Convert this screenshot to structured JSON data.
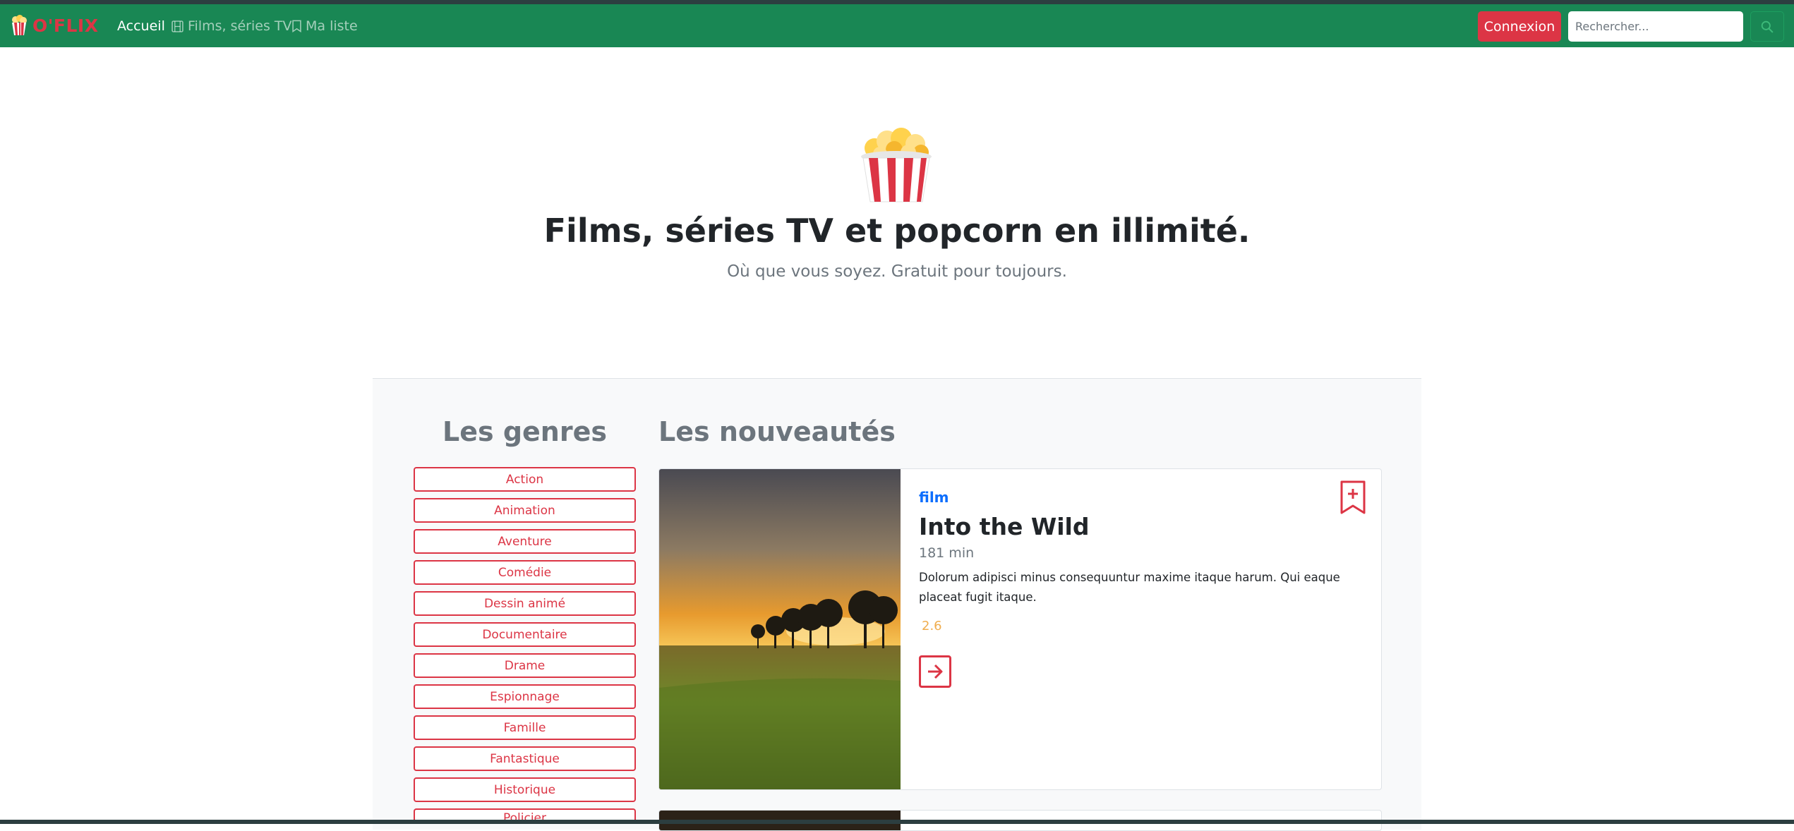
{
  "navbar": {
    "brand": "O'FLIX",
    "links": [
      {
        "label": "Accueil"
      },
      {
        "label": "Films, séries TV"
      },
      {
        "label": "Ma liste"
      }
    ],
    "login_label": "Connexion",
    "search_placeholder": "Rechercher..."
  },
  "hero": {
    "title": "Films, séries TV et popcorn en illimité.",
    "subtitle": "Où que vous soyez. Gratuit pour toujours."
  },
  "genres": {
    "title": "Les genres",
    "items": [
      "Action",
      "Animation",
      "Aventure",
      "Comédie",
      "Dessin animé",
      "Documentaire",
      "Drame",
      "Espionnage",
      "Famille",
      "Fantastique",
      "Historique",
      "Policier"
    ]
  },
  "news": {
    "title": "Les nouveautés",
    "cards": [
      {
        "type": "film",
        "title": "Into the Wild",
        "duration": "181 min",
        "description": "Dolorum adipisci minus consequuntur maxime itaque harum. Qui eaque placeat fugit itaque.",
        "rating": "2.6"
      }
    ]
  },
  "colors": {
    "navbar": "#198754",
    "accent": "#dc3545",
    "type_label": "#0d6efd",
    "rating": "#f0ad4e"
  },
  "icons": [
    "popcorn-icon",
    "film-icon",
    "bookmark-icon",
    "search-icon",
    "bookmark-plus-icon",
    "arrow-right-icon"
  ]
}
